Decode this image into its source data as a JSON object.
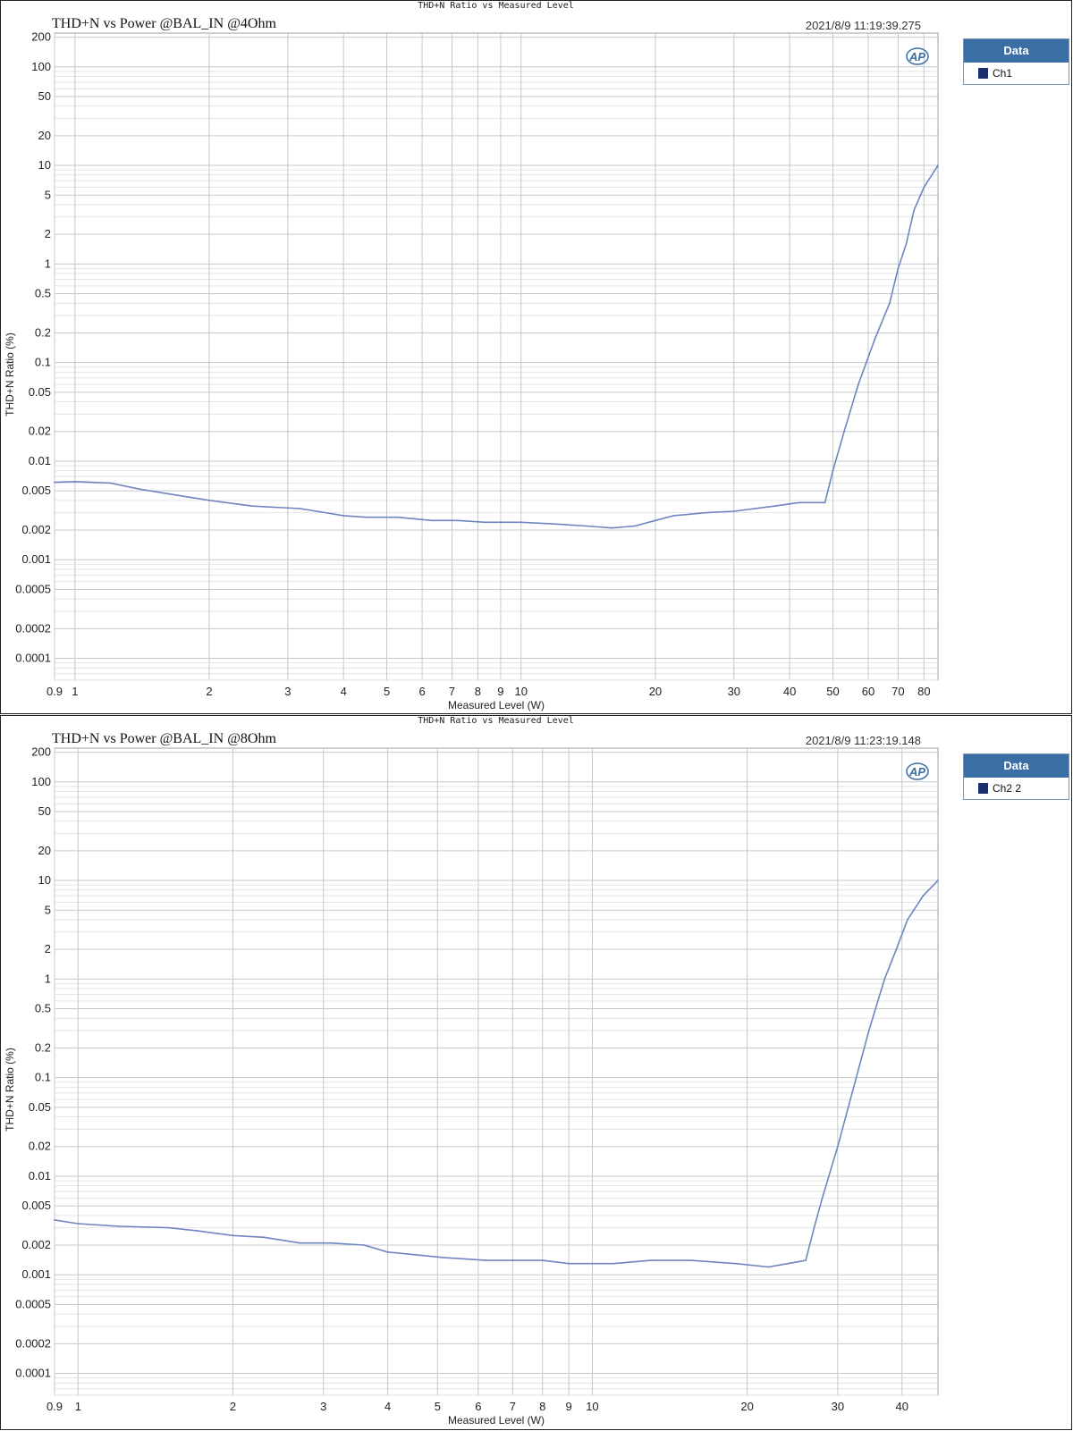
{
  "chart_data": [
    {
      "type": "line",
      "header": "THD+N Ratio vs Measured Level",
      "title": "THD+N vs Power @BAL_IN @4Ohm",
      "timestamp": "2021/8/9 11:19:39.275",
      "xlabel": "Measured Level (W)",
      "ylabel": "THD+N Ratio (%)",
      "x_scale": "log",
      "y_scale": "log",
      "xlim": [
        0.9,
        86
      ],
      "ylim": [
        6e-05,
        220
      ],
      "x_ticks": [
        "0.9",
        "1",
        "2",
        "3",
        "4",
        "5",
        "6",
        "7",
        "8",
        "9",
        "10",
        "20",
        "30",
        "40",
        "50",
        "60",
        "70",
        "80"
      ],
      "y_ticks": [
        "0.0001",
        "0.0002",
        "0.0005",
        "0.001",
        "0.002",
        "0.005",
        "0.01",
        "0.02",
        "0.05",
        "0.1",
        "0.2",
        "0.5",
        "1",
        "2",
        "5",
        "10",
        "20",
        "50",
        "100",
        "200"
      ],
      "grid": true,
      "legend_title": "Data",
      "legend_position": "right",
      "series": [
        {
          "name": "Ch1",
          "color": "#6f85c0",
          "points": [
            [
              0.9,
              0.0061
            ],
            [
              1.0,
              0.0062
            ],
            [
              1.2,
              0.006
            ],
            [
              1.4,
              0.0052
            ],
            [
              1.7,
              0.0045
            ],
            [
              2.0,
              0.004
            ],
            [
              2.5,
              0.0035
            ],
            [
              3.2,
              0.0033
            ],
            [
              4.0,
              0.0028
            ],
            [
              4.5,
              0.0027
            ],
            [
              5.3,
              0.0027
            ],
            [
              6.3,
              0.0025
            ],
            [
              7.2,
              0.0025
            ],
            [
              8.3,
              0.0024
            ],
            [
              10,
              0.0024
            ],
            [
              12,
              0.0023
            ],
            [
              14,
              0.0022
            ],
            [
              16,
              0.0021
            ],
            [
              18,
              0.0022
            ],
            [
              20,
              0.0025
            ],
            [
              22,
              0.0028
            ],
            [
              26,
              0.003
            ],
            [
              30,
              0.0031
            ],
            [
              37,
              0.0035
            ],
            [
              42,
              0.0038
            ],
            [
              48,
              0.0038
            ],
            [
              50,
              0.008
            ],
            [
              53,
              0.02
            ],
            [
              57,
              0.06
            ],
            [
              62,
              0.17
            ],
            [
              67,
              0.4
            ],
            [
              70,
              0.9
            ],
            [
              73,
              1.6
            ],
            [
              76,
              3.5
            ],
            [
              80,
              6
            ],
            [
              86,
              10
            ]
          ]
        }
      ]
    },
    {
      "type": "line",
      "header": "THD+N Ratio vs Measured Level",
      "title": "THD+N vs Power @BAL_IN @8Ohm",
      "timestamp": "2021/8/9 11:23:19.148",
      "xlabel": "Measured Level (W)",
      "ylabel": "THD+N Ratio (%)",
      "x_scale": "log",
      "y_scale": "log",
      "xlim": [
        0.9,
        47
      ],
      "ylim": [
        6e-05,
        220
      ],
      "x_ticks": [
        "0.9",
        "1",
        "2",
        "3",
        "4",
        "5",
        "6",
        "7",
        "8",
        "9",
        "10",
        "20",
        "30",
        "40"
      ],
      "y_ticks": [
        "0.0001",
        "0.0002",
        "0.0005",
        "0.001",
        "0.002",
        "0.005",
        "0.01",
        "0.02",
        "0.05",
        "0.1",
        "0.2",
        "0.5",
        "1",
        "2",
        "5",
        "10",
        "20",
        "50",
        "100",
        "200"
      ],
      "grid": true,
      "legend_title": "Data",
      "legend_position": "right",
      "series": [
        {
          "name": "Ch2 2",
          "color": "#6f85c0",
          "points": [
            [
              0.9,
              0.0036
            ],
            [
              1.0,
              0.0033
            ],
            [
              1.2,
              0.0031
            ],
            [
              1.5,
              0.003
            ],
            [
              1.7,
              0.0028
            ],
            [
              2.0,
              0.0025
            ],
            [
              2.3,
              0.0024
            ],
            [
              2.7,
              0.0021
            ],
            [
              3.1,
              0.0021
            ],
            [
              3.6,
              0.002
            ],
            [
              4.0,
              0.0017
            ],
            [
              4.5,
              0.0016
            ],
            [
              5.1,
              0.0015
            ],
            [
              6.2,
              0.0014
            ],
            [
              7.0,
              0.0014
            ],
            [
              8.0,
              0.0014
            ],
            [
              9.0,
              0.0013
            ],
            [
              10,
              0.0013
            ],
            [
              11,
              0.0013
            ],
            [
              13,
              0.0014
            ],
            [
              15.5,
              0.0014
            ],
            [
              19,
              0.0013
            ],
            [
              22,
              0.0012
            ],
            [
              24,
              0.0013
            ],
            [
              26,
              0.0014
            ],
            [
              27,
              0.003
            ],
            [
              28,
              0.006
            ],
            [
              30,
              0.02
            ],
            [
              32,
              0.07
            ],
            [
              34.5,
              0.3
            ],
            [
              37,
              1.0
            ],
            [
              39,
              2.0
            ],
            [
              41,
              4.0
            ],
            [
              44,
              7.0
            ],
            [
              47,
              10
            ]
          ]
        }
      ]
    }
  ]
}
